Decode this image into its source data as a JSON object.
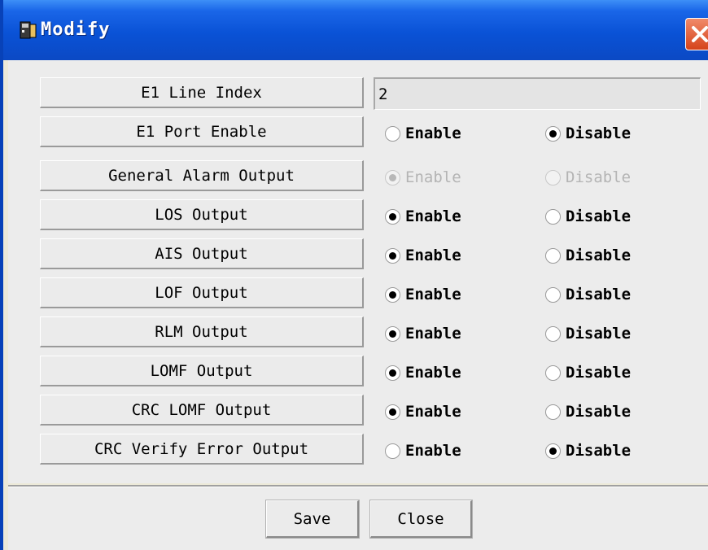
{
  "window": {
    "title": "Modify",
    "title_icon": "app-icon",
    "close_icon": "close-icon"
  },
  "fields": {
    "e1_line_index": {
      "label": "E1 Line Index",
      "value": "2"
    },
    "rows": [
      {
        "label": "E1 Port Enable",
        "enable": "Enable",
        "disable": "Disable",
        "selected": "disable",
        "disabled": false
      },
      {
        "label": "General Alarm Output",
        "enable": "Enable",
        "disable": "Disable",
        "selected": "enable",
        "disabled": true
      },
      {
        "label": "LOS Output",
        "enable": "Enable",
        "disable": "Disable",
        "selected": "enable",
        "disabled": false
      },
      {
        "label": "AIS Output",
        "enable": "Enable",
        "disable": "Disable",
        "selected": "enable",
        "disabled": false
      },
      {
        "label": "LOF Output",
        "enable": "Enable",
        "disable": "Disable",
        "selected": "enable",
        "disabled": false
      },
      {
        "label": "RLM Output",
        "enable": "Enable",
        "disable": "Disable",
        "selected": "enable",
        "disabled": false
      },
      {
        "label": "LOMF Output",
        "enable": "Enable",
        "disable": "Disable",
        "selected": "enable",
        "disabled": false
      },
      {
        "label": "CRC LOMF Output",
        "enable": "Enable",
        "disable": "Disable",
        "selected": "enable",
        "disabled": false
      },
      {
        "label": "CRC Verify Error Output",
        "enable": "Enable",
        "disable": "Disable",
        "selected": "disable",
        "disabled": false
      }
    ]
  },
  "buttons": {
    "save": "Save",
    "close": "Close"
  },
  "colors": {
    "titlebar": "#0a52d6",
    "close_button": "#d5431b",
    "dialog_bg": "#ececec"
  }
}
